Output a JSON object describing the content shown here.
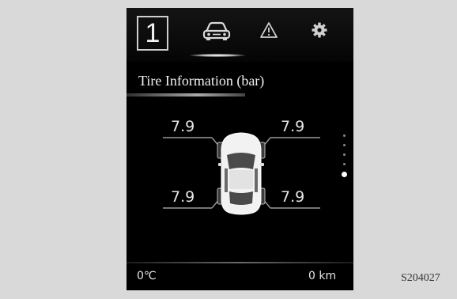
{
  "topbar": {
    "page_number": "1",
    "icons": [
      "car-icon",
      "warning-icon",
      "gear-icon"
    ],
    "active_tab": "car-icon"
  },
  "title": "Tire Information (bar)",
  "tires": {
    "front_left": "7.9",
    "front_right": "7.9",
    "rear_left": "7.9",
    "rear_right": "7.9"
  },
  "pagination": {
    "total": 5,
    "active_index": 5
  },
  "status": {
    "temperature": "0℃",
    "distance": "0 km"
  },
  "figure_code": "S204027",
  "colors": {
    "panel_background": "#000000",
    "page_background": "#d9d9d9",
    "text": "#e6e6e6"
  }
}
